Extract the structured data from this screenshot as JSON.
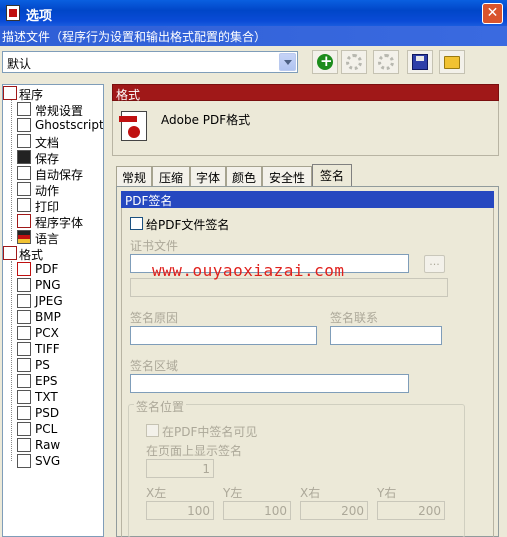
{
  "window": {
    "title": "选项",
    "close_glyph": "✕"
  },
  "description": "描述文件（程序行为设置和输出格式配置的集合）",
  "profile": {
    "selected": "默认"
  },
  "toolbar": [
    "add-icon",
    "gear-icon",
    "delete-icon",
    "save-icon",
    "folder-icon"
  ],
  "tree": {
    "program": {
      "label": "程序",
      "children": [
        "常规设置",
        "Ghostscript",
        "文档",
        "保存",
        "自动保存",
        "动作",
        "打印",
        "程序字体",
        "语言"
      ]
    },
    "formats": {
      "label": "格式",
      "children": [
        "PDF",
        "PNG",
        "JPEG",
        "BMP",
        "PCX",
        "TIFF",
        "PS",
        "EPS",
        "TXT",
        "PSD",
        "PCL",
        "Raw",
        "SVG"
      ],
      "selected": "PDF"
    }
  },
  "panel": {
    "header": "格式",
    "format_title": "Adobe PDF格式"
  },
  "tabs": {
    "items": [
      "常规",
      "压缩",
      "字体",
      "颜色",
      "安全性",
      "签名"
    ],
    "active": "签名"
  },
  "signing": {
    "section_title": "PDF签名",
    "sign_checkbox_label": "给PDF文件签名",
    "cert_label": "证书文件",
    "browse_label": "...",
    "reason_label": "签名原因",
    "contact_label": "签名联系",
    "location_label": "签名区域",
    "position_group": "签名位置",
    "visible_label": "在PDF中签名可见",
    "page_label": "在页面上显示签名",
    "page_value": "1",
    "coords": [
      {
        "label": "X左",
        "value": "100"
      },
      {
        "label": "Y左",
        "value": "100"
      },
      {
        "label": "X右",
        "value": "200"
      },
      {
        "label": "Y右",
        "value": "200"
      }
    ]
  },
  "watermark": "www.ouyaoxiazai.com",
  "colors": {
    "title_bar": "#0046C8",
    "panel_header": "#A01818",
    "section_header": "#2648C0",
    "watermark": "#E0201C"
  }
}
